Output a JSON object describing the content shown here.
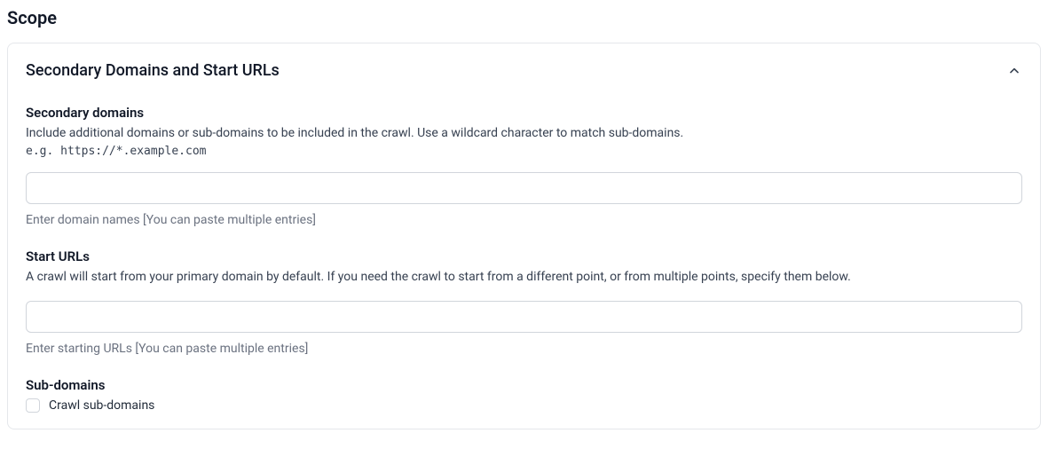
{
  "page": {
    "title": "Scope"
  },
  "panel": {
    "title": "Secondary Domains and Start URLs",
    "expanded": true
  },
  "secondary_domains": {
    "label": "Secondary domains",
    "description": "Include additional domains or sub-domains to be included in the crawl. Use a wildcard character to match sub-domains.",
    "example": "e.g. https://*.example.com",
    "value": "",
    "hint": "Enter domain names [You can paste multiple entries]"
  },
  "start_urls": {
    "label": "Start URLs",
    "description": "A crawl will start from your primary domain by default. If you need the crawl to start from a different point, or from multiple points, specify them below.",
    "value": "",
    "hint": "Enter starting URLs [You can paste multiple entries]"
  },
  "sub_domains": {
    "label": "Sub-domains",
    "checkbox_label": "Crawl sub-domains",
    "checked": false
  }
}
